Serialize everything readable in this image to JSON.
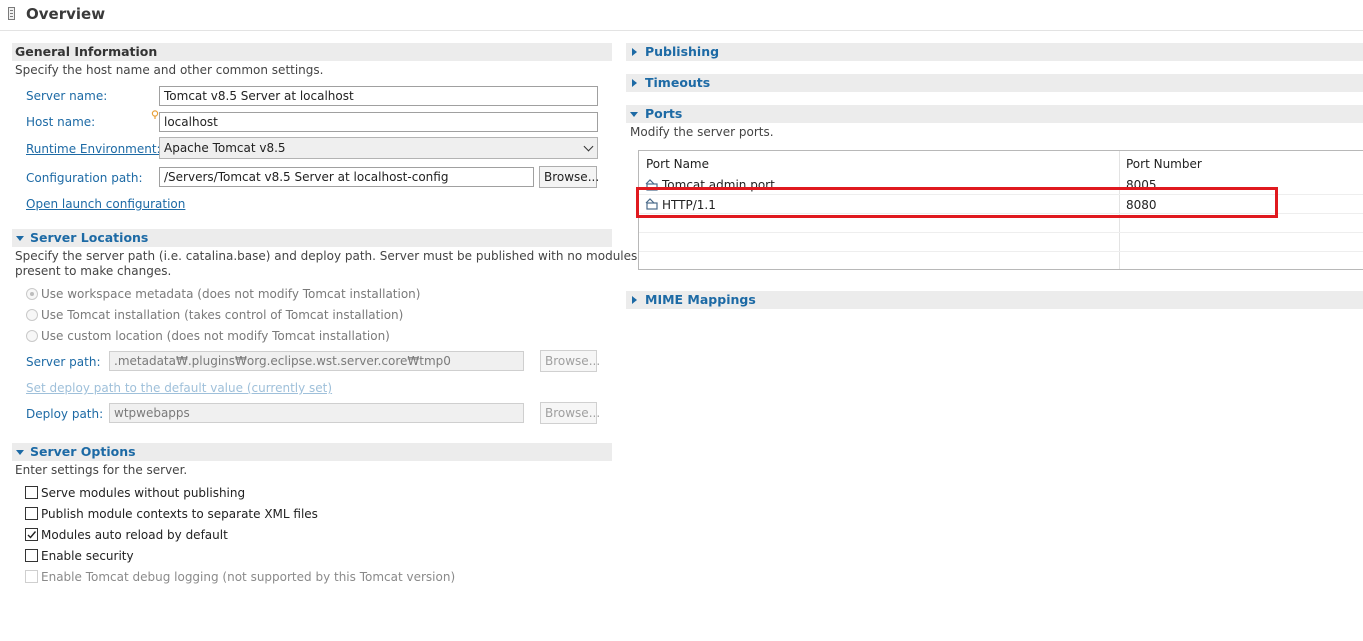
{
  "page": {
    "title": "Overview"
  },
  "general": {
    "title": "General Information",
    "description": "Specify the host name and other common settings.",
    "server_name_label": "Server name:",
    "server_name_value": "Tomcat v8.5 Server at localhost",
    "host_name_label": "Host name:",
    "host_name_value": "localhost",
    "runtime_label": "Runtime Environment:",
    "runtime_value": "Apache Tomcat v8.5",
    "config_path_label": "Configuration path:",
    "config_path_value": "/Servers/Tomcat v8.5 Server at localhost-config",
    "browse_label": "Browse...",
    "open_launch_label": "Open launch configuration"
  },
  "locations": {
    "title": "Server Locations",
    "description_line1": "Specify the server path (i.e. catalina.base) and deploy path. Server must be published with no modules",
    "description_line2": "present to make changes.",
    "options": [
      {
        "label": "Use workspace metadata (does not modify Tomcat installation)",
        "selected": true
      },
      {
        "label": "Use Tomcat installation (takes control of Tomcat installation)",
        "selected": false
      },
      {
        "label": "Use custom location (does not modify Tomcat installation)",
        "selected": false
      }
    ],
    "server_path_label": "Server path:",
    "server_path_value": ".metadata₩.plugins₩org.eclipse.wst.server.core₩tmp0",
    "set_default_label": "Set deploy path to the default value (currently set)",
    "deploy_path_label": "Deploy path:",
    "deploy_path_value": "wtpwebapps",
    "browse_label": "Browse..."
  },
  "options": {
    "title": "Server Options",
    "description": "Enter settings for the server.",
    "items": [
      {
        "label": "Serve modules without publishing",
        "checked": false,
        "enabled": true
      },
      {
        "label": "Publish module contexts to separate XML files",
        "checked": false,
        "enabled": true
      },
      {
        "label": "Modules auto reload by default",
        "checked": true,
        "enabled": true
      },
      {
        "label": "Enable security",
        "checked": false,
        "enabled": true
      },
      {
        "label": "Enable Tomcat debug logging (not supported by this Tomcat version)",
        "checked": false,
        "enabled": false
      }
    ]
  },
  "right": {
    "publishing_title": "Publishing",
    "timeouts_title": "Timeouts",
    "ports_title": "Ports",
    "ports_description": "Modify the server ports.",
    "mime_title": "MIME Mappings"
  },
  "ports_table": {
    "headers": [
      "Port Name",
      "Port Number"
    ],
    "rows": [
      {
        "name": "Tomcat admin port",
        "number": "8005"
      },
      {
        "name": "HTTP/1.1",
        "number": "8080"
      }
    ]
  },
  "colors": {
    "accent": "#1d6aa5",
    "highlight": "#e0191f",
    "section_bg": "#ececec"
  }
}
